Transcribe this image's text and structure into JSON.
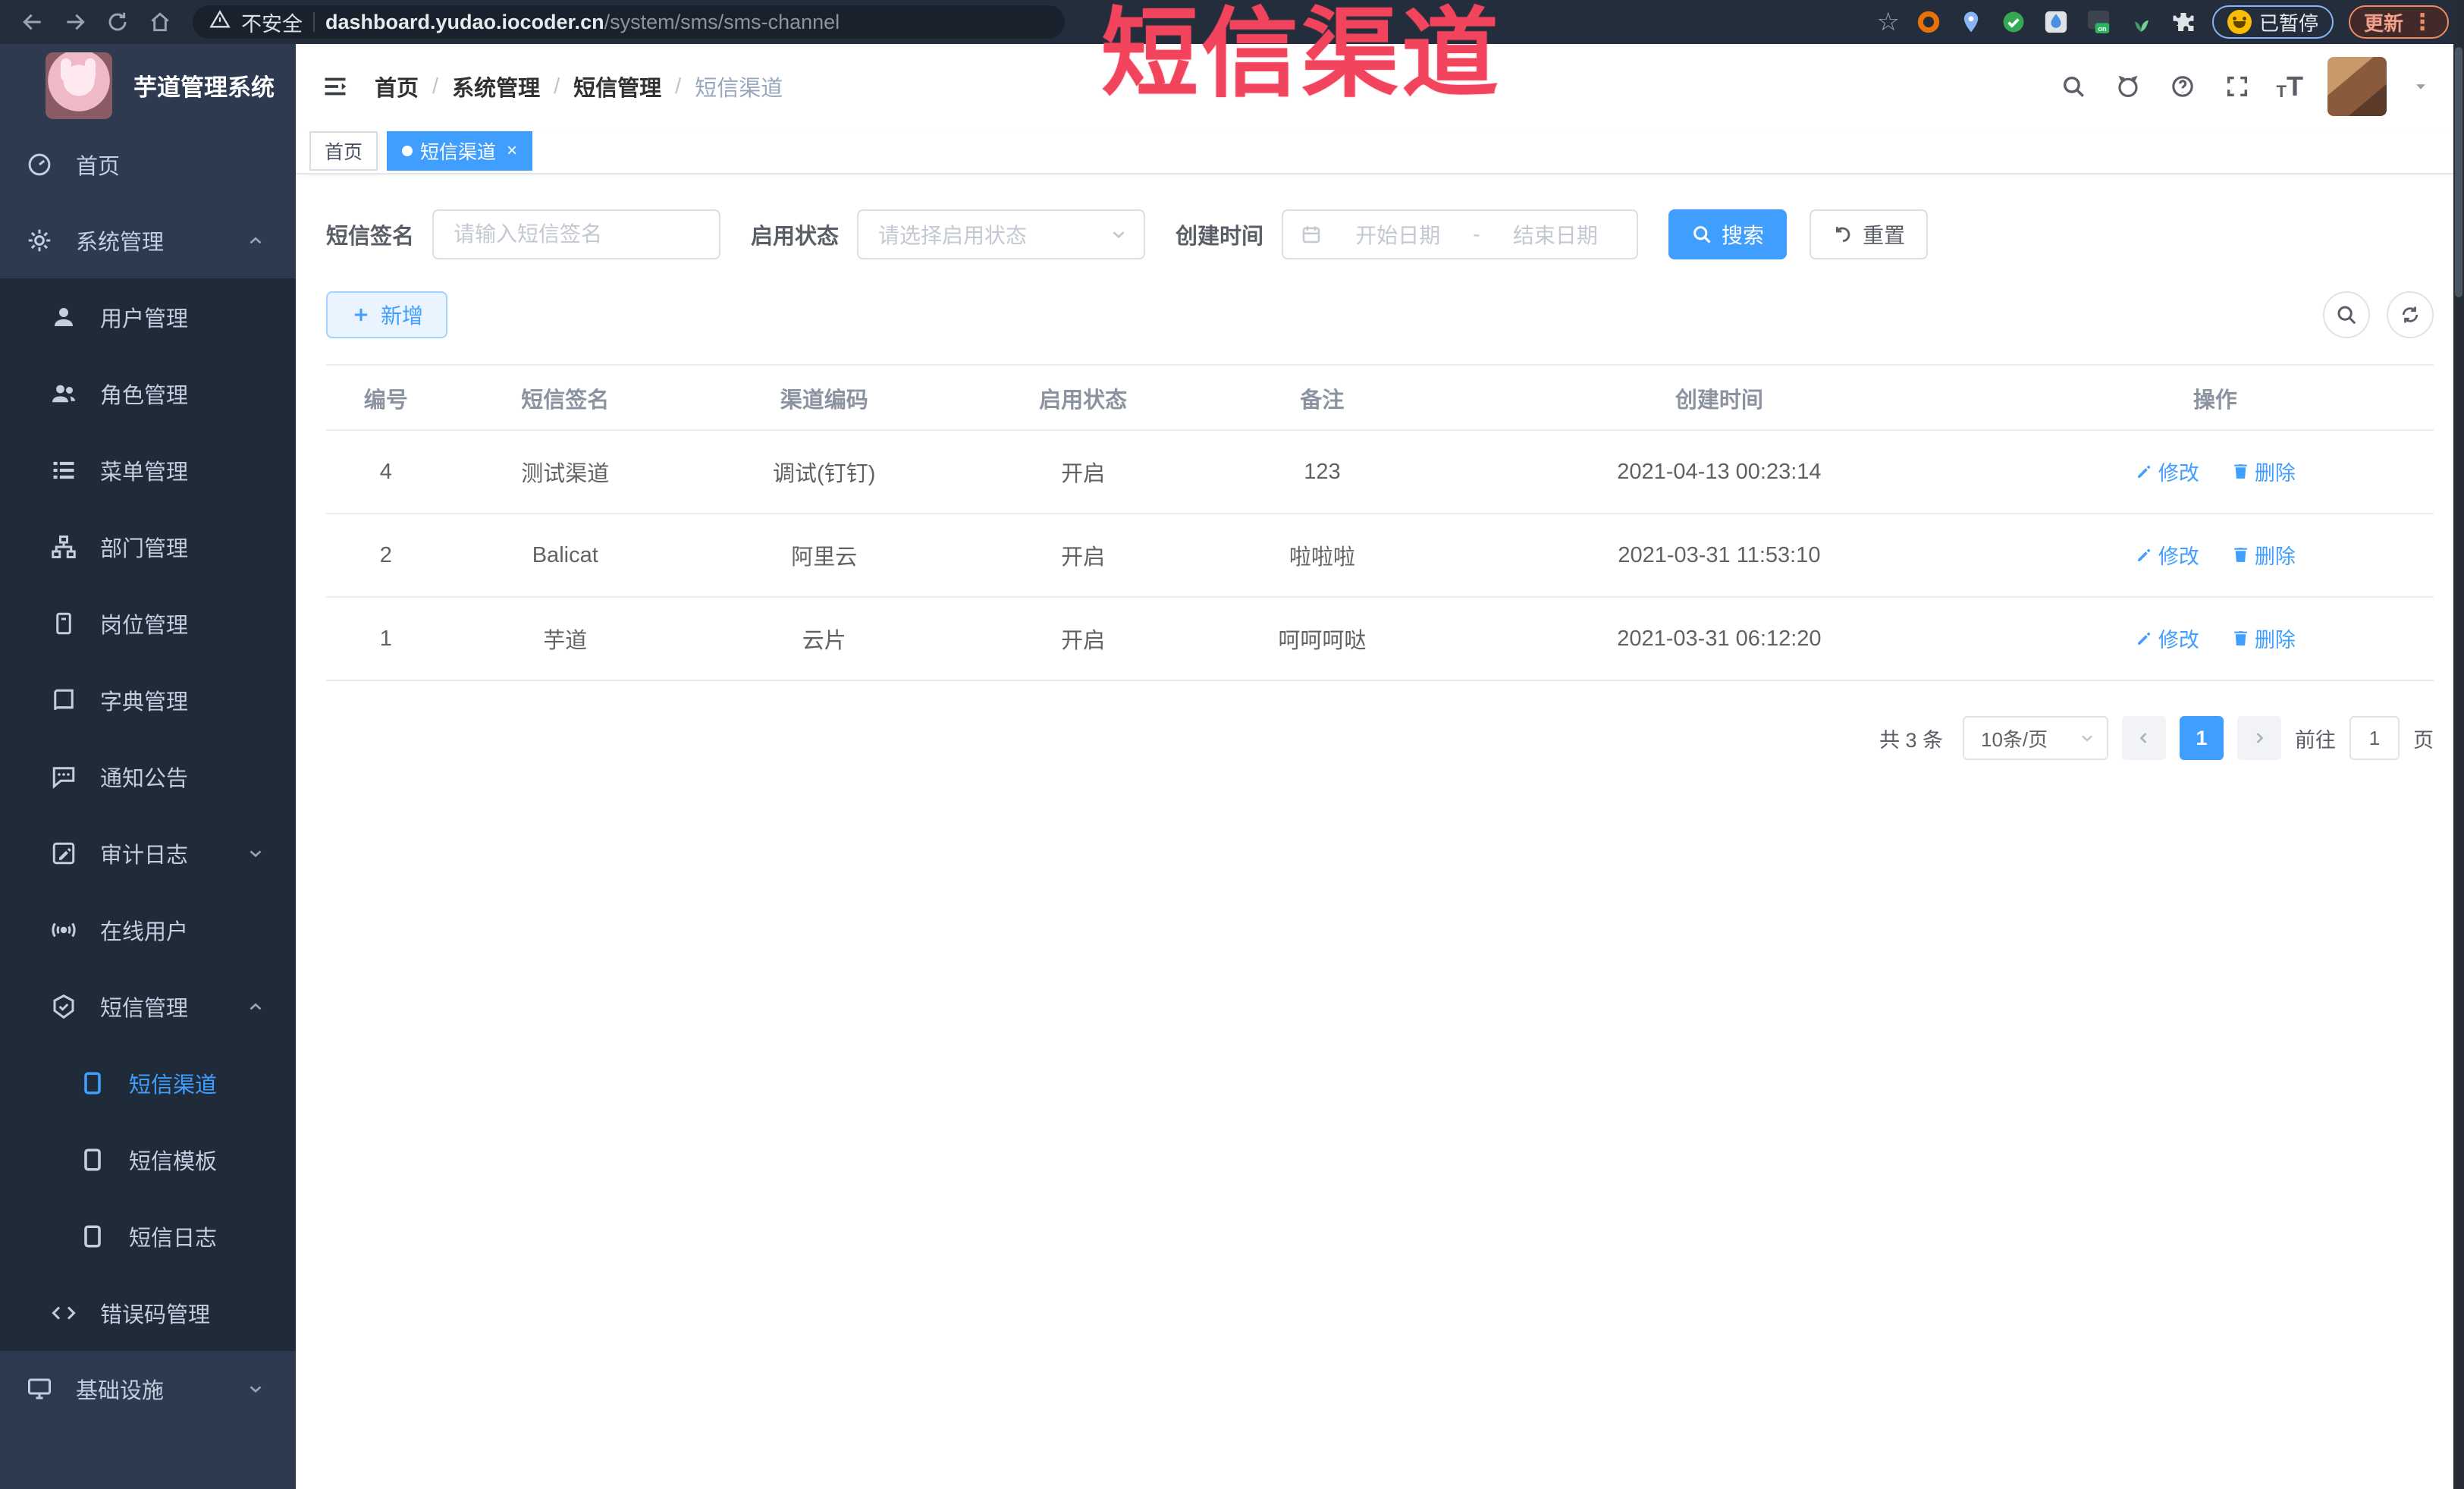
{
  "browser": {
    "security_label": "不安全",
    "url_domain": "dashboard.yudao.iocoder.cn",
    "url_path": "/system/sms/sms-channel",
    "paused_label": "已暂停",
    "update_label": "更新"
  },
  "overlay": {
    "title": "短信渠道"
  },
  "colors": {
    "accent": "#409eff",
    "overlay_red": "#f2455d",
    "sidebar_bg": "#2d3a50",
    "sidebar_submenu_bg": "#202b3a"
  },
  "sidebar": {
    "app_title": "芋道管理系统",
    "items": [
      {
        "label": "首页"
      },
      {
        "label": "系统管理"
      },
      {
        "label": "用户管理"
      },
      {
        "label": "角色管理"
      },
      {
        "label": "菜单管理"
      },
      {
        "label": "部门管理"
      },
      {
        "label": "岗位管理"
      },
      {
        "label": "字典管理"
      },
      {
        "label": "通知公告"
      },
      {
        "label": "审计日志"
      },
      {
        "label": "在线用户"
      },
      {
        "label": "短信管理"
      },
      {
        "label": "短信渠道"
      },
      {
        "label": "短信模板"
      },
      {
        "label": "短信日志"
      },
      {
        "label": "错误码管理"
      },
      {
        "label": "基础设施"
      }
    ]
  },
  "header": {
    "breadcrumb": [
      "首页",
      "系统管理",
      "短信管理",
      "短信渠道"
    ]
  },
  "tabs": [
    {
      "label": "首页"
    },
    {
      "label": "短信渠道"
    }
  ],
  "filters": {
    "sign_label": "短信签名",
    "sign_placeholder": "请输入短信签名",
    "status_label": "启用状态",
    "status_placeholder": "请选择启用状态",
    "date_label": "创建时间",
    "date_start_placeholder": "开始日期",
    "date_separator": "-",
    "date_end_placeholder": "结束日期",
    "search_label": "搜索",
    "reset_label": "重置"
  },
  "toolbar": {
    "add_label": "新增"
  },
  "table": {
    "headers": [
      "编号",
      "短信签名",
      "渠道编码",
      "启用状态",
      "备注",
      "创建时间",
      "操作"
    ],
    "edit_label": "修改",
    "delete_label": "删除",
    "rows": [
      {
        "id": "4",
        "sign": "测试渠道",
        "code": "调试(钉钉)",
        "status": "开启",
        "remark": "123",
        "created": "2021-04-13 00:23:14"
      },
      {
        "id": "2",
        "sign": "Balicat",
        "code": "阿里云",
        "status": "开启",
        "remark": "啦啦啦",
        "created": "2021-03-31 11:53:10"
      },
      {
        "id": "1",
        "sign": "芋道",
        "code": "云片",
        "status": "开启",
        "remark": "呵呵呵哒",
        "created": "2021-03-31 06:12:20"
      }
    ]
  },
  "pagination": {
    "total": "共 3 条",
    "page_size": "10条/页",
    "current_page": "1",
    "goto_label": "前往",
    "goto_value": "1",
    "unit_label": "页"
  }
}
